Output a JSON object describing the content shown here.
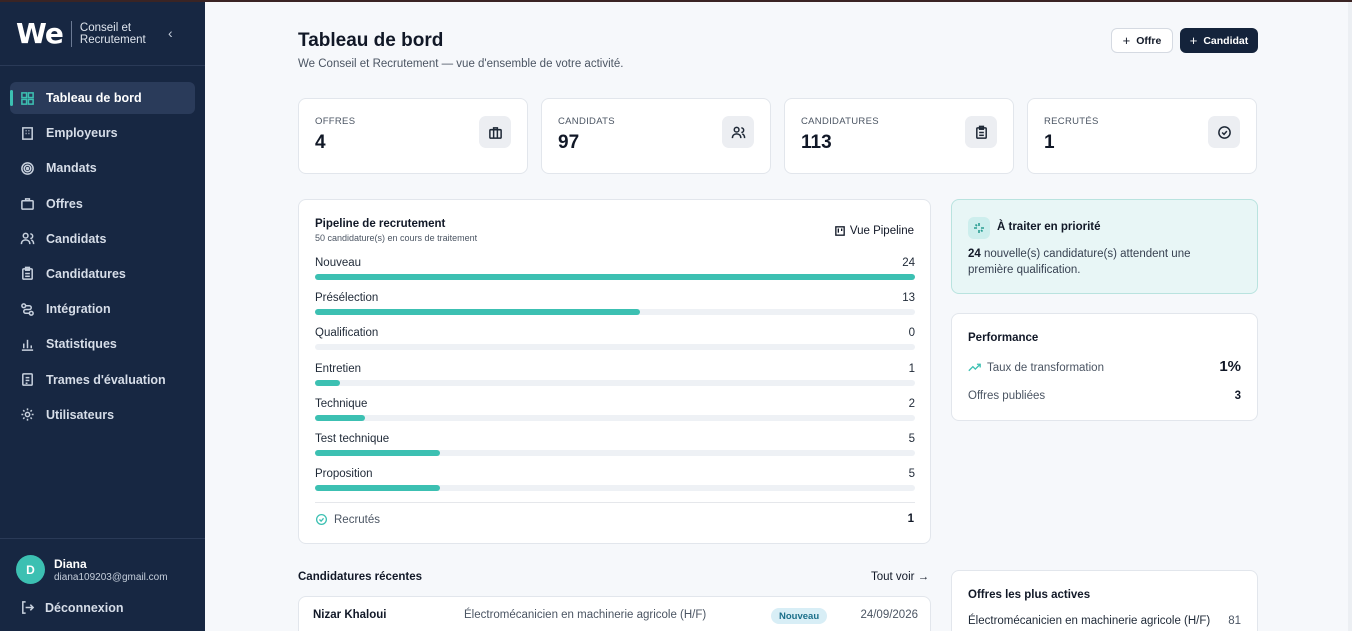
{
  "brand": {
    "logo": "We",
    "name": "Conseil et Recrutement"
  },
  "sidebar": {
    "items": [
      {
        "label": "Tableau de bord",
        "icon": "dashboard-icon",
        "active": true
      },
      {
        "label": "Employeurs",
        "icon": "building-icon"
      },
      {
        "label": "Mandats",
        "icon": "target-icon"
      },
      {
        "label": "Offres",
        "icon": "briefcase-icon"
      },
      {
        "label": "Candidats",
        "icon": "users-icon"
      },
      {
        "label": "Candidatures",
        "icon": "clipboard-icon"
      },
      {
        "label": "Intégration",
        "icon": "route-icon"
      },
      {
        "label": "Statistiques",
        "icon": "bar-chart-icon"
      },
      {
        "label": "Trames d'évaluation",
        "icon": "checklist-icon"
      },
      {
        "label": "Utilisateurs",
        "icon": "gear-icon"
      }
    ],
    "user": {
      "initial": "D",
      "name": "Diana",
      "email": "diana109203@gmail.com"
    },
    "logout_label": "Déconnexion"
  },
  "header": {
    "title": "Tableau de bord",
    "subtitle": "We Conseil et Recrutement — vue d'ensemble de votre activité.",
    "btn_offre": "Offre",
    "btn_candidat": "Candidat"
  },
  "stats": [
    {
      "label": "OFFRES",
      "value": "4",
      "icon": "briefcase-icon"
    },
    {
      "label": "CANDIDATS",
      "value": "97",
      "icon": "users-icon"
    },
    {
      "label": "CANDIDATURES",
      "value": "113",
      "icon": "clipboard-icon"
    },
    {
      "label": "RECRUTÉS",
      "value": "1",
      "icon": "check-circle-icon"
    }
  ],
  "pipeline": {
    "title": "Pipeline de recrutement",
    "subtitle": "50 candidature(s) en cours de traitement",
    "link": "Vue Pipeline",
    "max": 24,
    "stages": [
      {
        "name": "Nouveau",
        "count": 24
      },
      {
        "name": "Présélection",
        "count": 13
      },
      {
        "name": "Qualification",
        "count": 0
      },
      {
        "name": "Entretien",
        "count": 1
      },
      {
        "name": "Technique",
        "count": 2
      },
      {
        "name": "Test technique",
        "count": 5
      },
      {
        "name": "Proposition",
        "count": 5
      }
    ],
    "recrutes_label": "Recrutés",
    "recrutes_count": "1"
  },
  "priority": {
    "title": "À traiter en priorité",
    "count": "24",
    "text": " nouvelle(s) candidature(s) attendent une première qualification."
  },
  "performance": {
    "title": "Performance",
    "row1_label": "Taux de transformation",
    "row1_value": "1%",
    "row2_label": "Offres publiées",
    "row2_value": "3"
  },
  "recent": {
    "title": "Candidatures récentes",
    "link": "Tout voir →",
    "rows": [
      {
        "name": "Nizar Khaloui",
        "job": "Électromécanicien en machinerie agricole (H/F)",
        "status": "Nouveau",
        "date": "24/09/2026"
      }
    ]
  },
  "active_offers": {
    "title": "Offres les plus actives",
    "rows": [
      {
        "job": "Électromécanicien en machinerie agricole (H/F)",
        "count": "81"
      }
    ]
  },
  "colors": {
    "sidebar": "#172742",
    "accent": "#3cc0b2",
    "primary_button": "#14233b"
  }
}
